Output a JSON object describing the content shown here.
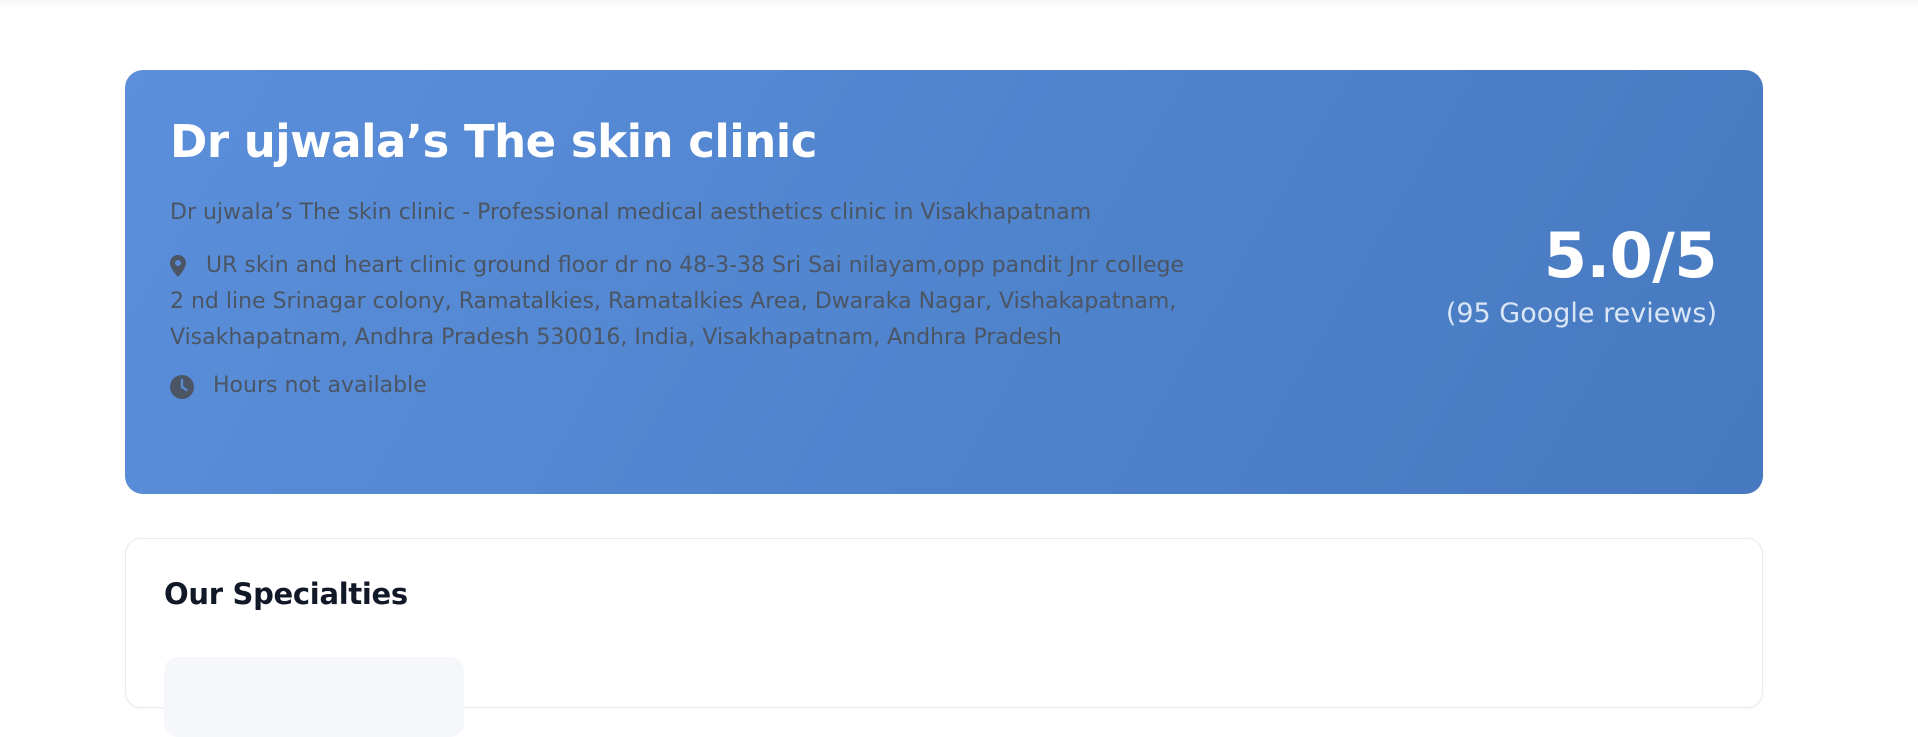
{
  "clinic": {
    "name": "Dr ujwala’s The skin clinic",
    "description": "Dr ujwala’s The skin clinic - Professional medical aesthetics clinic in Visakhapatnam",
    "address": "UR skin and heart clinic ground floor dr no 48-3-38 Sri Sai nilayam,opp pandit Jnr college 2 nd line Srinagar colony, Ramatalkies, Ramatalkies Area, Dwaraka Nagar, Vishakapatnam, Visakhapatnam, Andhra Pradesh 530016, India, Visakhapatnam, Andhra Pradesh",
    "hours": "Hours not available",
    "icons": {
      "address": "map-pin-icon",
      "hours": "clock-icon"
    }
  },
  "rating": {
    "value": "5.0/5",
    "reviews": "(95 Google reviews)"
  },
  "specialties": {
    "title": "Our Specialties"
  },
  "colors": {
    "hero_gradient_start": "#5b8fdb",
    "hero_gradient_end": "#4679bf",
    "muted_text": "#4b5563",
    "heading_dark": "#111827"
  }
}
